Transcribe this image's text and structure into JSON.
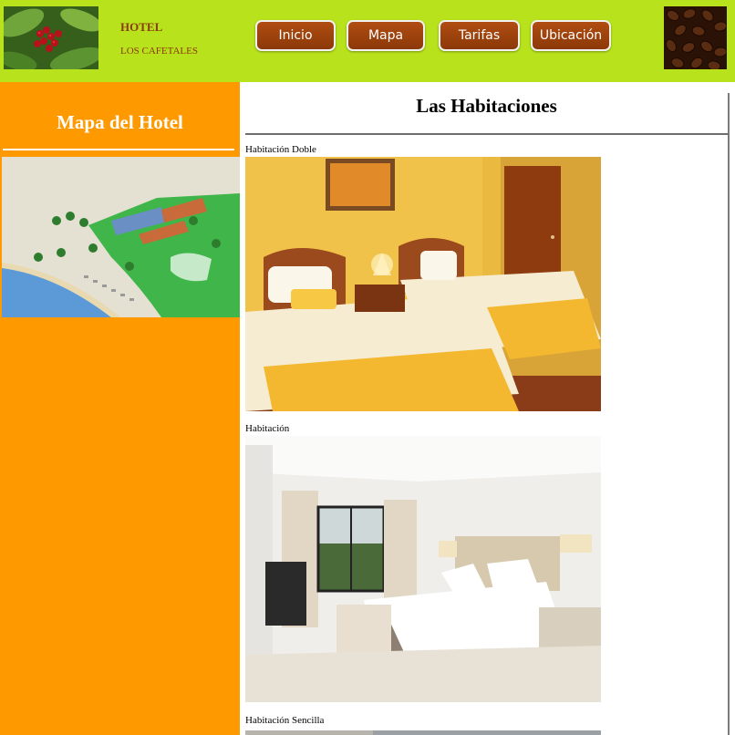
{
  "header": {
    "brand_title": "HOTEL",
    "brand_subtitle": "LOS CAFETALES",
    "nav": [
      {
        "label": "Inicio"
      },
      {
        "label": "Mapa"
      },
      {
        "label": "Tarifas"
      },
      {
        "label": "Ubicación"
      }
    ],
    "left_image_icon": "coffee-plant-image",
    "right_image_icon": "coffee-beans-image"
  },
  "sidebar": {
    "title": "Mapa del Hotel",
    "map_image_icon": "hotel-map-image"
  },
  "main": {
    "title": "Las Habitaciones",
    "rooms": [
      {
        "label": "Habitación Doble"
      },
      {
        "label": "Habitación"
      },
      {
        "label": "Habitación Sencilla"
      }
    ]
  },
  "colors": {
    "header_bg": "#b8e21c",
    "sidebar_bg": "#ff9900",
    "nav_button_bg": "#9c420c",
    "brand_text": "#8b3a0c"
  }
}
